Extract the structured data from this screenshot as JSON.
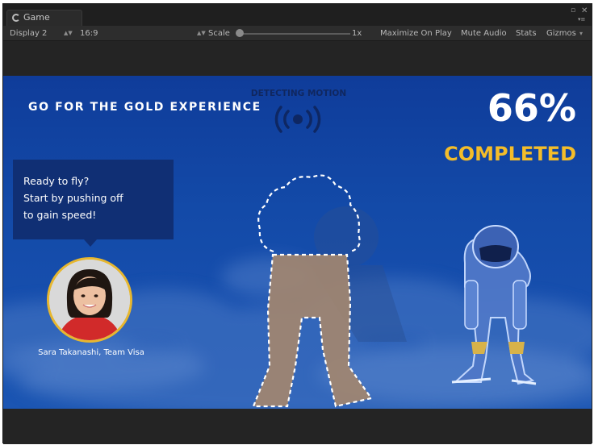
{
  "window": {
    "tab_label": "Game",
    "menu_glyph": "▾≡"
  },
  "toolbar": {
    "display": "Display 2",
    "aspect": "16:9",
    "scale_label": "Scale",
    "scale_value": "1x",
    "maximize_on_play": "Maximize On Play",
    "mute_audio": "Mute Audio",
    "stats": "Stats",
    "gizmos": "Gizmos"
  },
  "game": {
    "title": "GO FOR THE GOLD EXPERIENCE",
    "detecting": "DETECTING MOTION",
    "percent": "66%",
    "completed": "COMPLETED",
    "bubble_lines": [
      "Ready to fly?",
      "Start by pushing off",
      "to gain speed!"
    ],
    "caption": "Sara Takanashi, Team Visa",
    "progress": 0.66
  },
  "colors": {
    "game_bg": "#134aa8",
    "accent_gold": "#f4bd2a",
    "bubble_bg": "#102f74",
    "editor_dark": "#282828"
  },
  "icons": [
    "unity-icon",
    "maximize-icon",
    "close-icon",
    "panel-menu-icon",
    "motion-signal-icon"
  ]
}
